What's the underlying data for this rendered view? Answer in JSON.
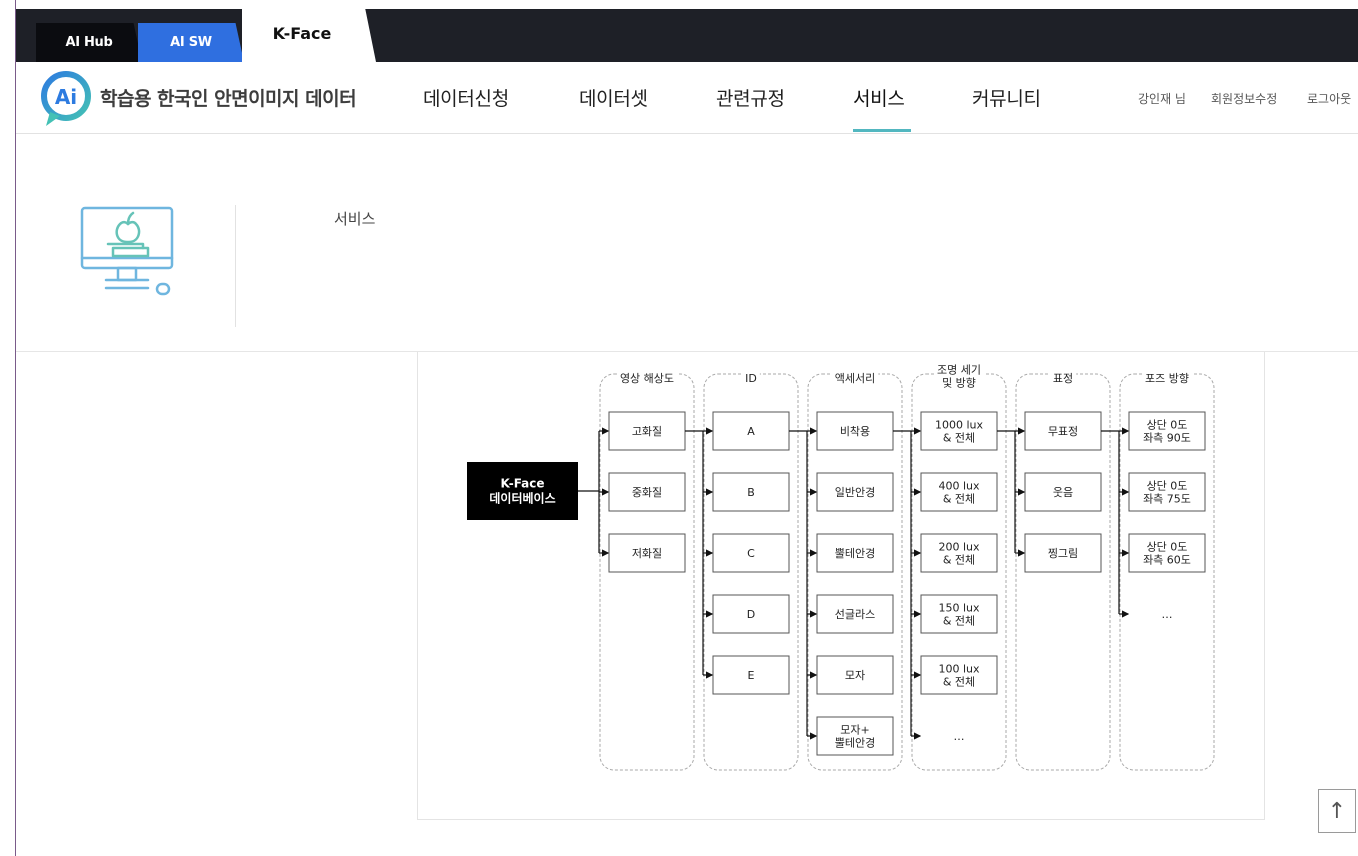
{
  "tabs": [
    {
      "label": "AI Hub"
    },
    {
      "label": "AI SW"
    },
    {
      "label": "K-Face"
    }
  ],
  "site": {
    "title": "학습용 한국인 안면이미지 데이터"
  },
  "nav": {
    "items": [
      {
        "label": "데이터신청"
      },
      {
        "label": "데이터셋"
      },
      {
        "label": "관련규정"
      },
      {
        "label": "서비스"
      },
      {
        "label": "커뮤니티"
      }
    ],
    "active": "서비스"
  },
  "user_menu": {
    "greeting": "강인재 님",
    "edit_profile": "회원정보수정",
    "logout": "로그아웃"
  },
  "hero": {
    "title": "서비스"
  },
  "diagram": {
    "root": {
      "line1": "K-Face",
      "line2": "데이터베이스"
    },
    "columns": [
      {
        "header": [
          "영상 해상도"
        ],
        "items": [
          [
            "고화질"
          ],
          [
            "중화질"
          ],
          [
            "저화질"
          ]
        ]
      },
      {
        "header": [
          "ID"
        ],
        "items": [
          [
            "A"
          ],
          [
            "B"
          ],
          [
            "C"
          ],
          [
            "D"
          ],
          [
            "E"
          ]
        ]
      },
      {
        "header": [
          "액세서리"
        ],
        "items": [
          [
            "비착용"
          ],
          [
            "일반안경"
          ],
          [
            "뿔테안경"
          ],
          [
            "선글라스"
          ],
          [
            "모자"
          ],
          [
            "모자+",
            "뿔테안경"
          ]
        ]
      },
      {
        "header": [
          "조명 세기",
          "및 방향"
        ],
        "items": [
          [
            "1000 lux",
            "& 전체"
          ],
          [
            "400 lux",
            "& 전체"
          ],
          [
            "200 lux",
            "& 전체"
          ],
          [
            "150 lux",
            "& 전체"
          ],
          [
            "100 lux",
            "& 전체"
          ],
          [
            "…"
          ]
        ],
        "last_plain": true
      },
      {
        "header": [
          "표정"
        ],
        "items": [
          [
            "무표정"
          ],
          [
            "웃음"
          ],
          [
            "찡그림"
          ]
        ]
      },
      {
        "header": [
          "포즈 방향"
        ],
        "items": [
          [
            "상단 0도",
            "좌측 90도"
          ],
          [
            "상단 0도",
            "좌측 75도"
          ],
          [
            "상단 0도",
            "좌측 60도"
          ],
          [
            "…"
          ]
        ],
        "last_plain": true
      }
    ]
  },
  "scroll_top": {
    "label": "↑"
  },
  "colors": {
    "topbar": "#1e2027",
    "tab_active_blue": "#2f6fe0",
    "accent": "#52b7c0",
    "root_box": "#000000"
  }
}
